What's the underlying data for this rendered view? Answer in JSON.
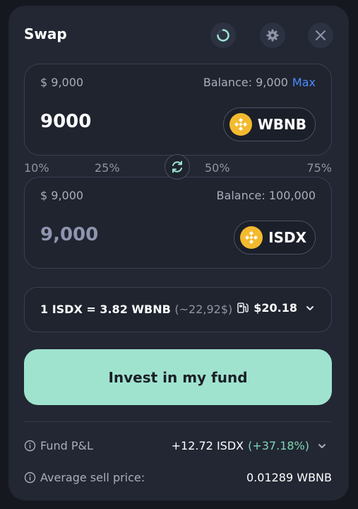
{
  "header": {
    "title": "Swap"
  },
  "from": {
    "usd_value": "$ 9,000",
    "balance": "Balance: 9,000",
    "max_label": "Max",
    "amount": "9000",
    "token": "WBNB"
  },
  "percent_options": [
    "10%",
    "25%",
    "50%",
    "75%"
  ],
  "to": {
    "usd_value": "$ 9,000",
    "balance": "Balance: 100,000",
    "amount": "9,000",
    "token": "ISDX"
  },
  "rate": {
    "text": "1 ISDX = 3.82 WBNB",
    "usd": "(~22,92$)",
    "gas": "$20.18"
  },
  "invest_label": "Invest in my fund",
  "info": {
    "fund_pnl_label": "Fund P&L",
    "fund_pnl_value": "+12.72 ISDX",
    "fund_pnl_percent": "(+37.18%)",
    "avg_sell_label": "Average sell price:",
    "avg_sell_value": "0.01289 WBNB"
  },
  "colors": {
    "accent_button": "#9fe3cf",
    "max_link": "#4d8cff",
    "token_icon": "#f3ba2f",
    "positive": "#7fd6b4"
  },
  "icons": [
    "loading-spinner-icon",
    "gear-icon",
    "close-icon",
    "bnb-token-icon",
    "swap-arrows-icon",
    "gas-pump-icon",
    "chevron-down-icon",
    "info-icon"
  ]
}
